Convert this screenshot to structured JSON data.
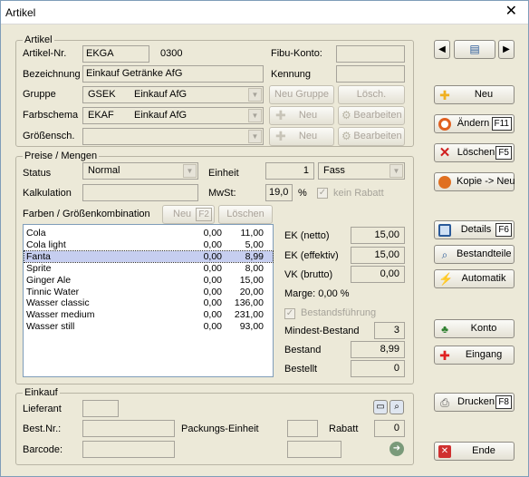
{
  "window": {
    "title": "Artikel",
    "close": "✕"
  },
  "artikel": {
    "group_title": "Artikel",
    "nr_label": "Artikel-Nr.",
    "nr_value": "EKGA",
    "nr_extra": "0300",
    "fibu_label": "Fibu-Konto:",
    "fibu_value": "",
    "bez_label": "Bezeichnung",
    "bez_value": "Einkauf Getränke AfG",
    "kennung_label": "Kennung",
    "kennung_value": "",
    "gruppe_label": "Gruppe",
    "gruppe_code": "GSEK",
    "gruppe_name": "Einkauf AfG",
    "neu_gruppe": "Neu Gruppe",
    "loesch": "Lösch.",
    "farb_label": "Farbschema",
    "farb_code": "EKAF",
    "farb_name": "Einkauf AfG",
    "groess_label": "Größensch.",
    "neu": "Neu",
    "bearbeiten": "Bearbeiten"
  },
  "preise": {
    "group_title": "Preise / Mengen",
    "status_label": "Status",
    "status_value": "Normal",
    "einheit_label": "Einheit",
    "einheit_qty": "1",
    "einheit_value": "Fass",
    "kalk_label": "Kalkulation",
    "kalk_value": "",
    "mwst_label": "MwSt:",
    "mwst_value": "19,0",
    "mwst_unit": "%",
    "kein_rabatt": "kein Rabatt",
    "farben_label": "Farben / Größenkombination",
    "neu_label": "Neu",
    "neu_key": "F2",
    "loeschen": "Löschen",
    "items": [
      {
        "name": "Cola",
        "a": "0,00",
        "b": "11,00"
      },
      {
        "name": "Cola light",
        "a": "0,00",
        "b": "5,00"
      },
      {
        "name": "Fanta",
        "a": "0,00",
        "b": "8,99"
      },
      {
        "name": "Sprite",
        "a": "0,00",
        "b": "8,00"
      },
      {
        "name": "Ginger Ale",
        "a": "0,00",
        "b": "15,00"
      },
      {
        "name": "Tinnic Water",
        "a": "0,00",
        "b": "20,00"
      },
      {
        "name": "Wasser classic",
        "a": "0,00",
        "b": "136,00"
      },
      {
        "name": "Wasser medium",
        "a": "0,00",
        "b": "231,00"
      },
      {
        "name": "Wasser still",
        "a": "0,00",
        "b": "93,00"
      }
    ],
    "selected_index": 2,
    "ek_netto_label": "EK (netto)",
    "ek_netto": "15,00",
    "ek_eff_label": "EK (effektiv)",
    "ek_eff": "15,00",
    "vk_label": "VK (brutto)",
    "vk": "0,00",
    "marge": "Marge: 0,00 %",
    "bestandsfuehrung": "Bestandsführung",
    "mindest_label": "Mindest-Bestand",
    "mindest": "3",
    "bestand_label": "Bestand",
    "bestand": "8,99",
    "bestellt_label": "Bestellt",
    "bestellt": "0"
  },
  "einkauf": {
    "group_title": "Einkauf",
    "lieferant_label": "Lieferant",
    "bestnr_label": "Best.Nr.:",
    "packung_label": "Packungs-Einheit",
    "rabatt_label": "Rabatt",
    "rabatt_value": "0",
    "barcode_label": "Barcode:"
  },
  "sidebar": {
    "neu": "Neu",
    "aendern": "Ändern",
    "aendern_key": "F11",
    "loeschen": "Löschen",
    "loeschen_key": "F5",
    "kopie": "Kopie -> Neu",
    "details": "Details",
    "details_key": "F6",
    "bestandteile": "Bestandteile",
    "automatik": "Automatik",
    "konto": "Konto",
    "eingang": "Eingang",
    "drucken": "Drucken",
    "drucken_key": "F8",
    "ende": "Ende"
  }
}
